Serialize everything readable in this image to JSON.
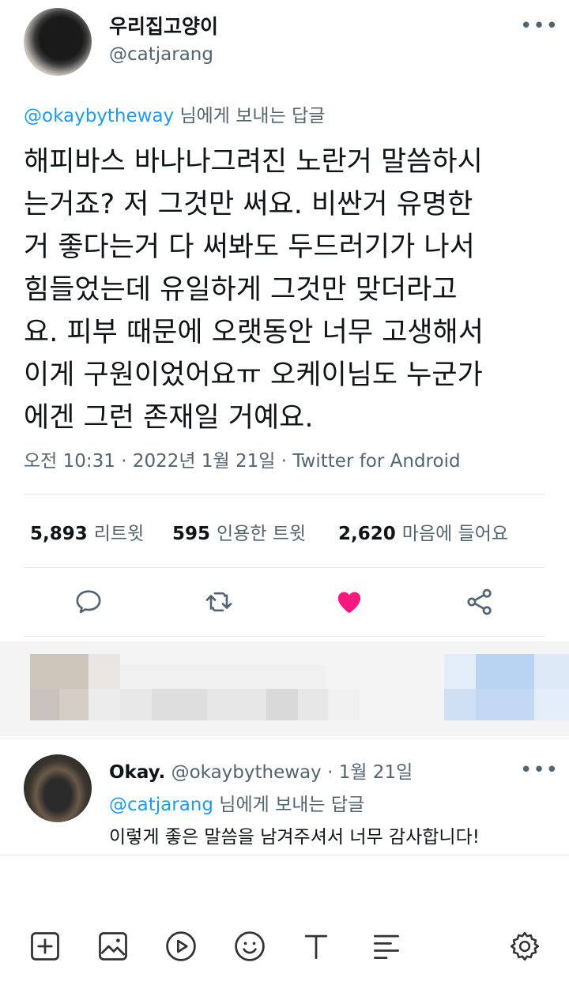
{
  "tweet": {
    "author_name": "우리집고양이",
    "author_handle": "@catjarang",
    "reply_to_handle": "@okaybytheway",
    "reply_to_suffix": " 님에게 보내는 답글",
    "text": "해피바스 바나나그려진 노란거 말씀하시\n는거죠? 저 그것만 써요. 비싼거 유명한\n거 좋다는거 다 써봐도 두드러기가 나서\n힘들었는데 유일하게 그것만 맞더라고\n요. 피부 때문에 오랫동안 너무 고생해서\n이게 구원이었어요ㅠ 오케이님도 누군가\n에겐 그런 존재일 거예요.",
    "meta": "오전 10:31 · 2022년 1월 21일 · Twitter for Android",
    "more": "•••"
  },
  "stats": {
    "retweets_count": "5,893",
    "retweets_label": "리트윗",
    "quotes_count": "595",
    "quotes_label": "인용한 트윗",
    "likes_count": "2,620",
    "likes_label": "마음에 들어요"
  },
  "reply": {
    "author_name": "Okay.",
    "author_handle": "@okaybytheway",
    "date": "1월 21일",
    "reply_to_handle": "@catjarang",
    "reply_to_suffix": " 님에게 보내는 답글",
    "text": "이렇게 좋은 말씀을 남겨주셔서 너무 감사합니다!",
    "more": "•••"
  },
  "colors": {
    "accent": "#1d9bf0",
    "like": "#f91880",
    "secondary_text": "#536471"
  },
  "icons": {
    "reply": "reply-icon",
    "retweet": "retweet-icon",
    "like": "heart-icon",
    "share": "share-icon",
    "toolbar": [
      "add-icon",
      "image-icon",
      "play-icon",
      "smile-icon",
      "text-icon",
      "list-icon",
      "gear-icon"
    ]
  }
}
